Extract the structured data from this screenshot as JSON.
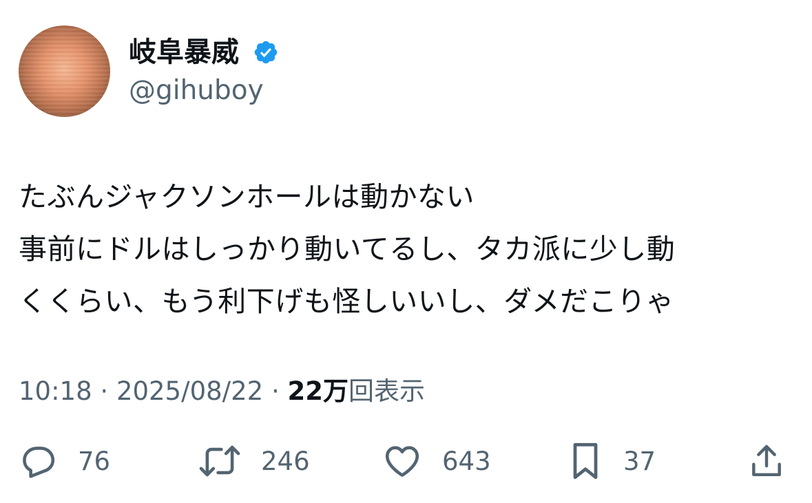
{
  "author": {
    "display_name": "岐阜暴威",
    "handle": "@gihuboy",
    "verified_icon": "verified-badge-icon"
  },
  "tweet": {
    "lines": [
      "たぶんジャクソンホールは動かない",
      "事前にドルはしっかり動いてるし、タカ派に少し動",
      "くくらい、もう利下げも怪しいいし、ダメだこりゃ"
    ]
  },
  "meta": {
    "time": "10:18",
    "separator": "·",
    "date": "2025/08/22",
    "views_count": "22万",
    "views_label": "回表示"
  },
  "actions": {
    "reply": {
      "icon": "reply-icon",
      "count": "76"
    },
    "repost": {
      "icon": "repost-icon",
      "count": "246"
    },
    "like": {
      "icon": "heart-icon",
      "count": "643"
    },
    "bookmark": {
      "icon": "bookmark-icon",
      "count": "37"
    },
    "share": {
      "icon": "share-icon"
    }
  },
  "colors": {
    "text": "#0f1419",
    "secondary": "#536471",
    "verified": "#1d9bf0"
  }
}
